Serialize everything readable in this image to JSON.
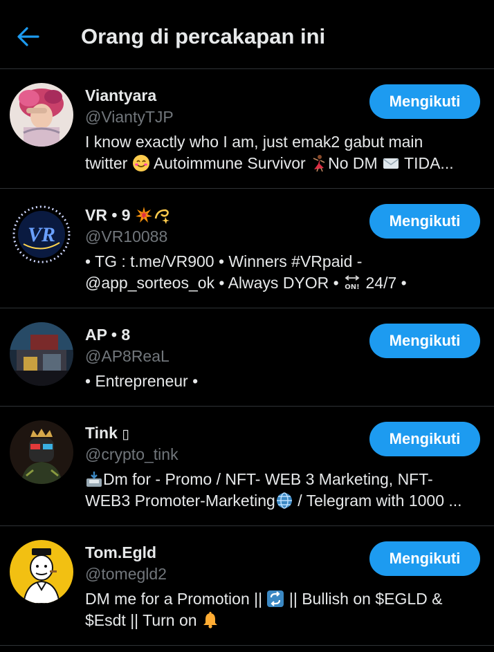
{
  "header": {
    "title": "Orang di percakapan ini",
    "back_icon": "arrow-left-icon"
  },
  "accent_color": "#1d9bf0",
  "users": [
    {
      "name": "Viantyara",
      "handle": "@ViantyTJP",
      "follow_label": "Mengikuti",
      "bio_line1": "I know exactly who I am, just emak2 gabut main",
      "bio_line2_a": "twitter ",
      "bio_line2_b": " Autoimmune Survivor ",
      "bio_line2_c": "No DM ",
      "bio_line2_d": " TIDA..."
    },
    {
      "name": "VR • 9 ",
      "handle": "@VR10088",
      "follow_label": "Mengikuti",
      "bio_line1": "• TG : t.me/VR900 • Winners #VRpaid -",
      "bio_line2_a": "@app_sorteos_ok • Always DYOR • ",
      "bio_line2_b": " 24/7 •"
    },
    {
      "name": "AP • 8",
      "handle": "@AP8ReaL",
      "follow_label": "Mengikuti",
      "bio_line1": "• Entrepreneur •"
    },
    {
      "name": "Tink ",
      "name_glyph": "▯",
      "handle": "@crypto_tink",
      "follow_label": "Mengikuti",
      "bio_line1": "Dm for - Promo / NFT- WEB 3 Marketing, NFT-",
      "bio_line2_a": "WEB3 Promoter-Marketing",
      "bio_line2_b": " / Telegram with 1000 ..."
    },
    {
      "name": "Tom.Egld",
      "handle": "@tomegld2",
      "follow_label": "Mengikuti",
      "bio_line1_a": "DM me for a Promotion || ",
      "bio_line1_b": " || Bullish on $EGLD &",
      "bio_line2": "$Esdt || Turn on "
    }
  ]
}
